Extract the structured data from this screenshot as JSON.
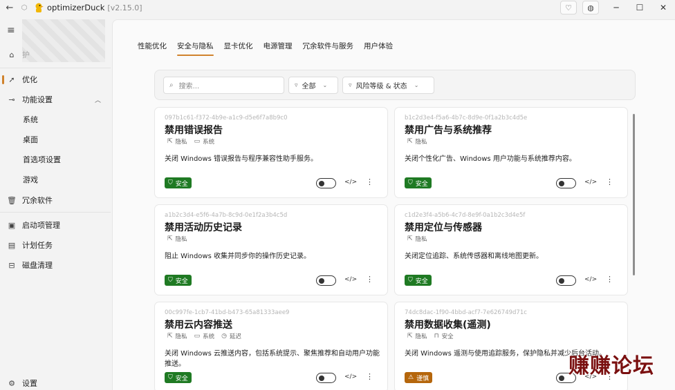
{
  "app": {
    "title": "optimizerDuck",
    "version": "[v2.15.0]"
  },
  "sidebar": {
    "items": [
      {
        "label": "优化",
        "icon": "rocket-icon"
      },
      {
        "label": "功能设置",
        "icon": "toggle-icon"
      },
      {
        "label": "系统"
      },
      {
        "label": "桌面"
      },
      {
        "label": "首选项设置"
      },
      {
        "label": "游戏"
      },
      {
        "label": "冗余软件",
        "icon": "trash-icon"
      },
      {
        "label": "启动项管理",
        "icon": "startup-icon"
      },
      {
        "label": "计划任务",
        "icon": "calendar-icon"
      },
      {
        "label": "磁盘清理",
        "icon": "disk-icon"
      },
      {
        "label": "设置",
        "icon": "gear-icon"
      }
    ],
    "home_label_partial": "护"
  },
  "tabs": [
    "性能优化",
    "安全与隐私",
    "显卡优化",
    "电源管理",
    "冗余软件与服务",
    "用户体验"
  ],
  "filter": {
    "search_placeholder": "搜索...",
    "category": "全部",
    "risk_status": "风险等级  &  状态"
  },
  "cards": [
    {
      "id": "097b1c61-f372-4b9e-a1c9-d5e6f7a8b9c0",
      "title": "禁用错误报告",
      "tags": [
        {
          "label": "隐私",
          "icon": "privacy-icon"
        },
        {
          "label": "系统",
          "icon": "monitor-icon"
        }
      ],
      "desc": "关闭 Windows 错误报告与程序兼容性助手服务。",
      "badge": "安全",
      "risk": "safe"
    },
    {
      "id": "b1c2d3e4-f5a6-4b7c-8d9e-0f1a2b3c4d5e",
      "title": "禁用广告与系统推荐",
      "tags": [
        {
          "label": "隐私",
          "icon": "privacy-icon"
        }
      ],
      "desc": "关闭个性化广告、Windows 用户功能与系统推荐内容。",
      "badge": "安全",
      "risk": "safe"
    },
    {
      "id": "a1b2c3d4-e5f6-4a7b-8c9d-0e1f2a3b4c5d",
      "title": "禁用活动历史记录",
      "tags": [
        {
          "label": "隐私",
          "icon": "privacy-icon"
        }
      ],
      "desc": "阻止 Windows 收集并同步你的操作历史记录。",
      "badge": "安全",
      "risk": "safe"
    },
    {
      "id": "c1d2e3f4-a5b6-4c7d-8e9f-0a1b2c3d4e5f",
      "title": "禁用定位与传感器",
      "tags": [
        {
          "label": "隐私",
          "icon": "privacy-icon"
        }
      ],
      "desc": "关闭定位追踪、系统传感器和离线地图更新。",
      "badge": "安全",
      "risk": "safe"
    },
    {
      "id": "00c997fe-1cb7-41bd-b473-65a81333aee9",
      "title": "禁用云内容推送",
      "tags": [
        {
          "label": "隐私",
          "icon": "privacy-icon"
        },
        {
          "label": "系统",
          "icon": "monitor-icon"
        },
        {
          "label": "延迟",
          "icon": "clock-icon"
        }
      ],
      "desc": "关闭 Windows 云推送内容，包括系统提示、聚焦推荐和自动用户功能推送。",
      "badge": "安全",
      "risk": "safe"
    },
    {
      "id": "74dc8dac-1f90-4bbd-acf7-7e626749d71c",
      "title": "禁用数据收集(遥测)",
      "tags": [
        {
          "label": "隐私",
          "icon": "privacy-icon"
        },
        {
          "label": "安全",
          "icon": "lock-icon"
        }
      ],
      "desc": "关闭 Windows 遥测与使用追踪服务，保护隐私并减少后台活动。",
      "badge": "谨慎",
      "risk": "caution"
    }
  ],
  "watermark": "赚赚论坛"
}
